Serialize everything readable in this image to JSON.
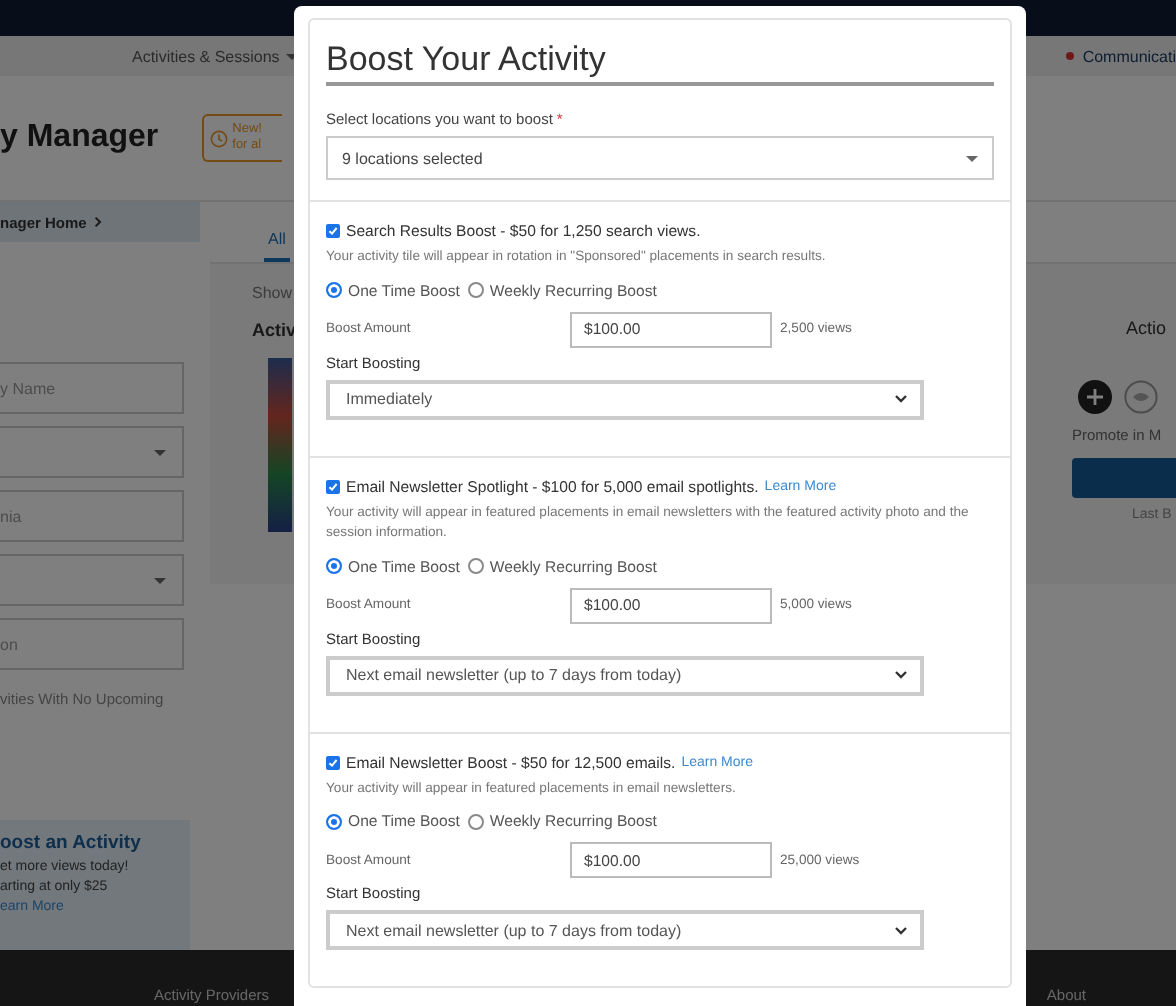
{
  "page": {
    "nav": {
      "item": "Activities & Sessions",
      "right_item": "Communicati"
    },
    "header": {
      "title": "y Manager",
      "badge_lines": [
        "New!",
        "for al"
      ]
    },
    "breadcrumb": "nager Home",
    "filters": [
      {
        "kind": "text",
        "placeholder": "y Name"
      },
      {
        "kind": "select"
      },
      {
        "kind": "text",
        "placeholder": "nia"
      },
      {
        "kind": "select"
      },
      {
        "kind": "text",
        "placeholder": "on"
      }
    ],
    "filter_note": "vities With No Upcoming",
    "promo": {
      "title": "oost an Activity",
      "lines": [
        "et more views today!",
        "arting at only $25"
      ],
      "link": "earn More"
    },
    "tabs": [
      {
        "label": "All",
        "selected": true
      }
    ],
    "showing": "Show",
    "activities_heading": "Activ",
    "actions": {
      "heading": "Actio",
      "promote": "Promote in M",
      "last": "Last B"
    },
    "footer": [
      "Activity Providers",
      "About"
    ]
  },
  "modal": {
    "title": "Boost Your Activity",
    "location_label": "Select locations you want to boost",
    "required_mark": "*",
    "location_value": "9 locations selected",
    "boosts": [
      {
        "label": "Search Results Boost - $50 for 1,250 search views.",
        "checked": true,
        "description": "Your activity tile will appear in rotation in \"Sponsored\" placements in search results.",
        "options": [
          {
            "label": "One Time Boost",
            "selected": true
          },
          {
            "label": "Weekly Recurring Boost",
            "selected": false
          }
        ],
        "amount_label": "Boost Amount",
        "amount": "$100.00",
        "views": "2,500 views",
        "start_label": "Start Boosting",
        "start": "Immediately"
      },
      {
        "label": "Email Newsletter Spotlight - $100 for 5,000 email spotlights.",
        "link": "Learn More",
        "checked": true,
        "description": "Your activity will appear in featured placements in email newsletters with the featured activity photo and the session information.",
        "options": [
          {
            "label": "One Time Boost",
            "selected": true
          },
          {
            "label": "Weekly Recurring Boost",
            "selected": false
          }
        ],
        "amount_label": "Boost Amount",
        "amount": "$100.00",
        "views": "5,000 views",
        "start_label": "Start Boosting",
        "start": "Next email newsletter (up to 7 days from today)"
      },
      {
        "label": "Email Newsletter Boost - $50 for 12,500 emails.",
        "link": "Learn More",
        "checked": true,
        "description": "Your activity will appear in featured placements in email newsletters.",
        "options": [
          {
            "label": "One Time Boost",
            "selected": true
          },
          {
            "label": "Weekly Recurring Boost",
            "selected": false
          }
        ],
        "amount_label": "Boost Amount",
        "amount": "$100.00",
        "views": "25,000 views",
        "start_label": "Start Boosting",
        "start": "Next email newsletter (up to 7 days from today)"
      }
    ]
  }
}
